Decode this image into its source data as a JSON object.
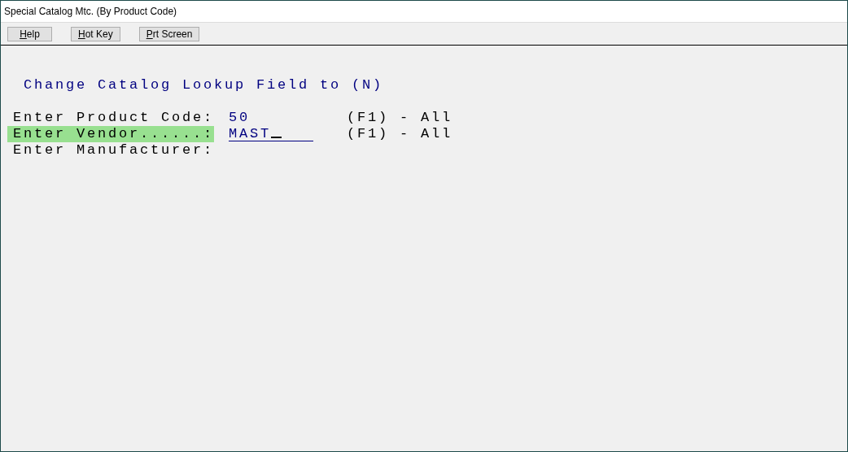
{
  "window": {
    "title": "Special Catalog Mtc. (By Product Code)"
  },
  "toolbar": [
    {
      "label": "Help"
    },
    {
      "label": "Hot Key"
    },
    {
      "label": "Prt Screen"
    }
  ],
  "heading": "Change Catalog Lookup Field to (N)",
  "fields": [
    {
      "label": "Enter Product Code:",
      "value": "50",
      "hint": "(F1) - All",
      "selected": false
    },
    {
      "label": "Enter Vendor......:",
      "value": "MAST",
      "hint": "(F1) - All",
      "selected": true,
      "cursor": true
    },
    {
      "label": "Enter Manufacturer:",
      "selected": false
    }
  ]
}
